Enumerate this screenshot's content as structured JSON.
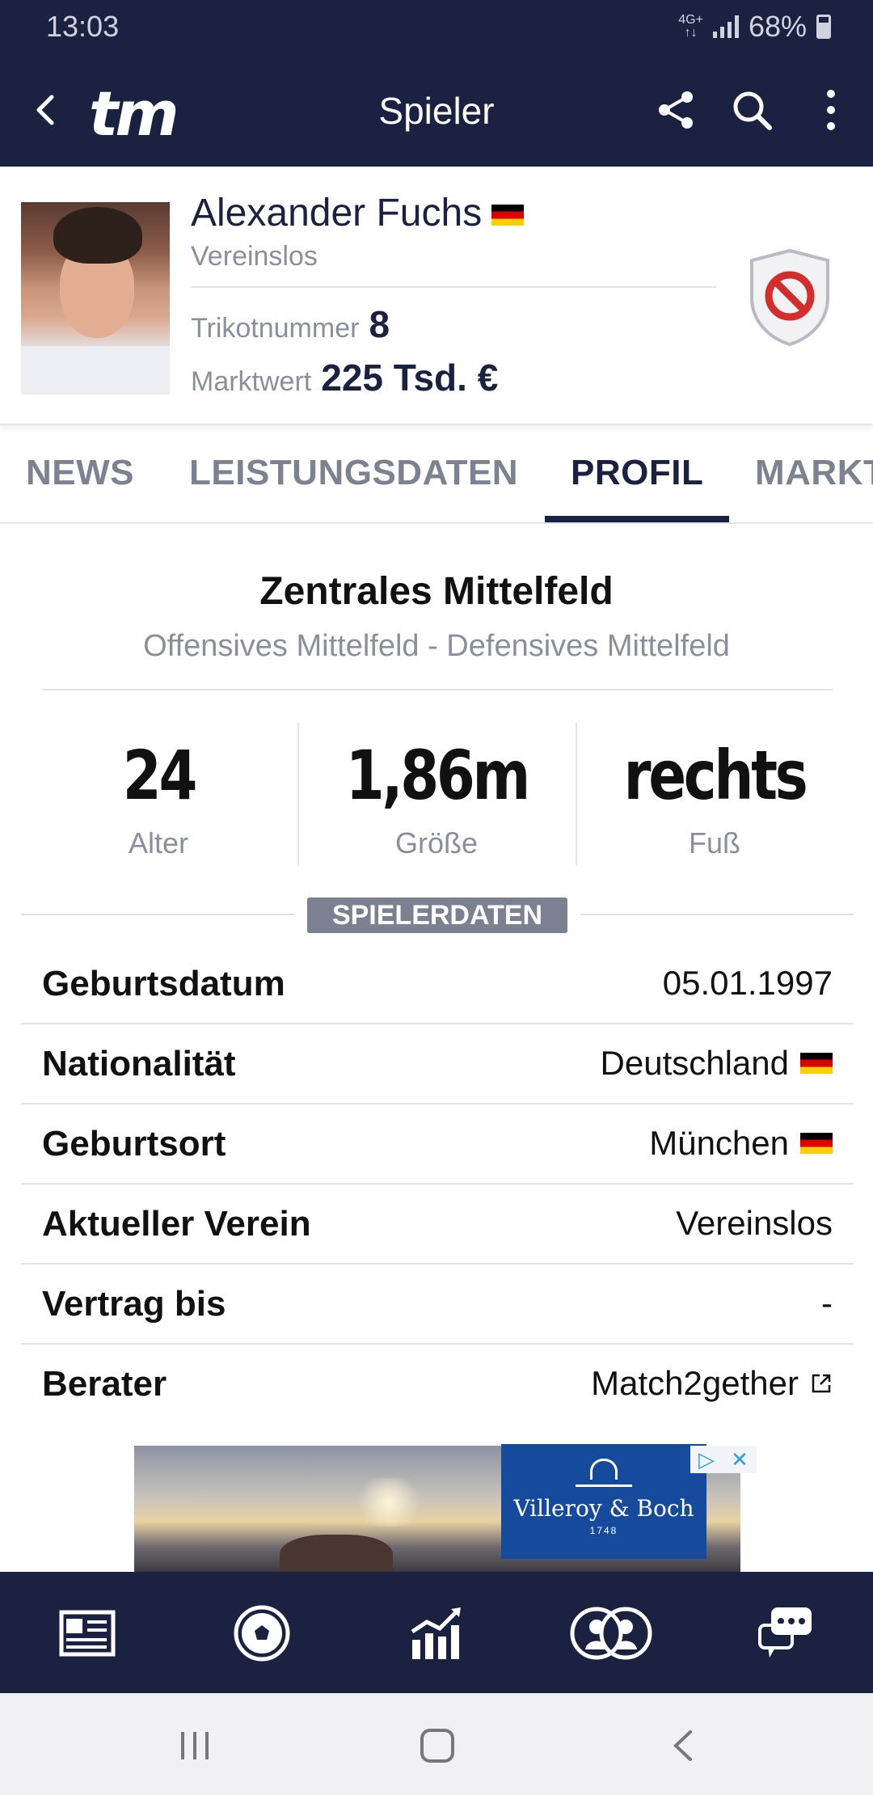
{
  "status_bar": {
    "time": "13:03",
    "network": "4G+",
    "battery": "68%"
  },
  "app_bar": {
    "logo": "tm",
    "title": "Spieler"
  },
  "player": {
    "name": "Alexander Fuchs",
    "club": "Vereinslos",
    "shirt_label": "Trikotnummer",
    "shirt_number": "8",
    "value_label": "Marktwert",
    "value": "225 Tsd. €"
  },
  "tabs": [
    {
      "label": "NEWS"
    },
    {
      "label": "LEISTUNGSDATEN"
    },
    {
      "label": "PROFIL"
    },
    {
      "label": "MARKT"
    }
  ],
  "active_tab": "PROFIL",
  "position": {
    "main": "Zentrales Mittelfeld",
    "secondary": "Offensives Mittelfeld - Defensives Mittelfeld"
  },
  "stats": [
    {
      "value": "24",
      "label": "Alter"
    },
    {
      "value": "1,86m",
      "label": "Größe"
    },
    {
      "value": "rechts",
      "label": "Fuß"
    }
  ],
  "section_title": "SPIELERDATEN",
  "details": [
    {
      "key": "Geburtsdatum",
      "value": "05.01.1997"
    },
    {
      "key": "Nationalität",
      "value": "Deutschland"
    },
    {
      "key": "Geburtsort",
      "value": "München"
    },
    {
      "key": "Aktueller Verein",
      "value": "Vereinslos"
    },
    {
      "key": "Vertrag bis",
      "value": "-"
    },
    {
      "key": "Berater",
      "value": "Match2gether"
    }
  ],
  "ad": {
    "brand": "Villeroy & Boch",
    "year": "1748"
  },
  "bottom_nav": [
    {
      "icon": "news-icon"
    },
    {
      "icon": "football-icon"
    },
    {
      "icon": "chart-icon"
    },
    {
      "icon": "transfer-icon"
    },
    {
      "icon": "chat-icon"
    }
  ],
  "colors": {
    "brand_navy": "#1b2140",
    "muted": "#8a8f9c",
    "badge": "#7b8190"
  }
}
